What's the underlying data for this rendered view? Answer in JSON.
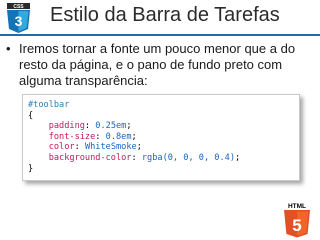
{
  "slide": {
    "title": "Estilo da Barra de Tarefas",
    "bullet_marker": "•",
    "bullet_text": "Iremos tornar a fonte um pouco menor que a do resto da página, e o pano de fundo preto com alguma transparência:"
  },
  "logos": {
    "css3_label": "CSS",
    "css3_number": "3",
    "html5_label": "HTML",
    "html5_number": "5"
  },
  "code": {
    "selector": "#toolbar",
    "open_brace": "{",
    "close_brace": "}",
    "declarations": [
      {
        "property": "padding",
        "value": "0.25em"
      },
      {
        "property": "font-size",
        "value": "0.8em"
      },
      {
        "property": "color",
        "value": "WhiteSmoke"
      },
      {
        "property": "background-color",
        "value": "rgba(0, 0, 0, 0.4)"
      }
    ],
    "colon": ":",
    "semicolon": ";",
    "indent": "    "
  },
  "colors": {
    "css3_blue": "#1572b6",
    "css3_light": "#33a9dc",
    "html5_orange": "#e34f26",
    "html5_light": "#f06529",
    "title_rule": "#2b6aa0"
  }
}
